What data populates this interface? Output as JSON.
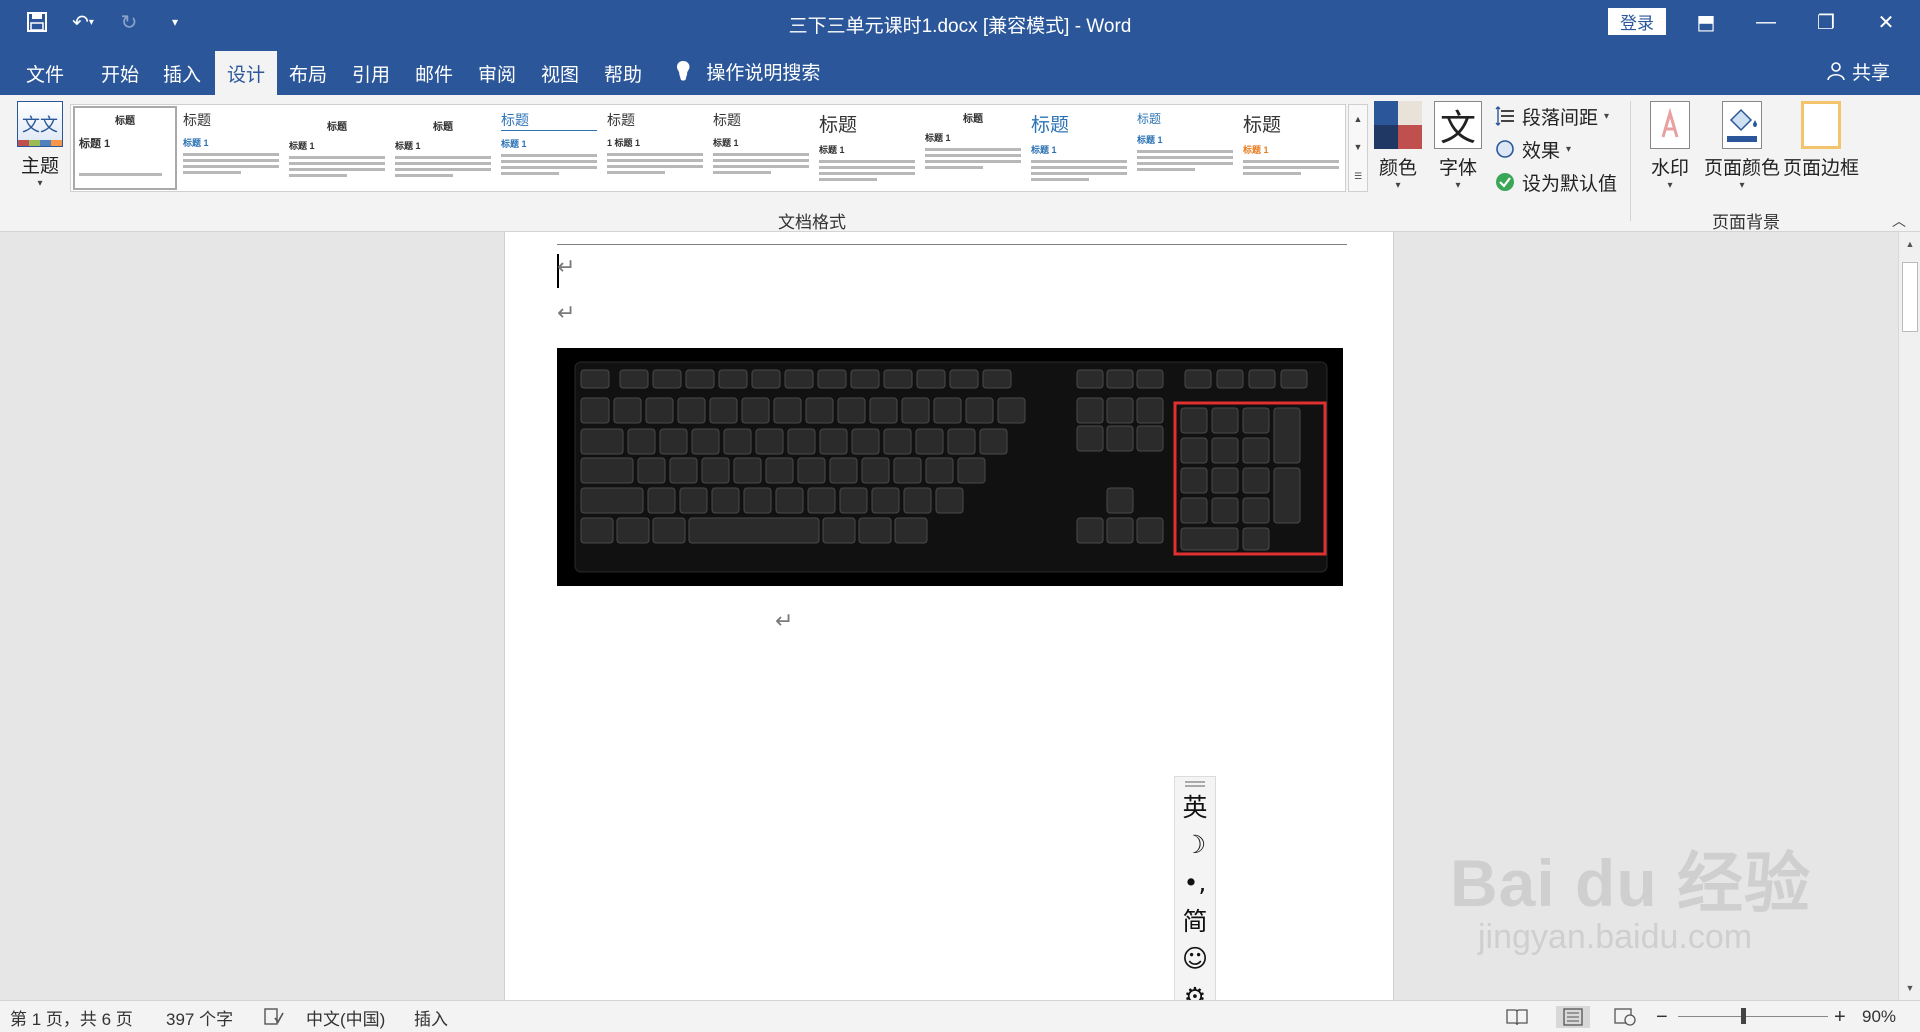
{
  "titlebar": {
    "title": "三下三单元课时1.docx [兼容模式]  -  Word",
    "login": "登录",
    "save_glyph": "💾",
    "undo_glyph": "↶",
    "undo_caret": "▾",
    "redo_glyph": "↻",
    "qat_more": "▾",
    "ribbon_display_glyph": "⬒",
    "minimize_glyph": "—",
    "restore_glyph": "❐",
    "close_glyph": "✕"
  },
  "tabs": [
    {
      "label": "文件"
    },
    {
      "label": "开始"
    },
    {
      "label": "插入"
    },
    {
      "label": "设计"
    },
    {
      "label": "布局"
    },
    {
      "label": "引用"
    },
    {
      "label": "邮件"
    },
    {
      "label": "审阅"
    },
    {
      "label": "视图"
    },
    {
      "label": "帮助"
    }
  ],
  "tell_me": {
    "label": "操作说明搜索",
    "icon": "lightbulb-icon",
    "glyph": "💡"
  },
  "share": {
    "label": "共享",
    "icon": "person-icon",
    "glyph": "👤"
  },
  "ribbon": {
    "theme": {
      "label": "主题",
      "glyph": "文文"
    },
    "styles": [
      {
        "title": "标题",
        "sub": "标题 1"
      },
      {
        "title": "标题",
        "sub": "标题 1"
      },
      {
        "title": "标题",
        "sub": "标题 1"
      },
      {
        "title": "标题",
        "sub": "标题 1"
      },
      {
        "title": "标题",
        "sub": "标题 1"
      },
      {
        "title": "标题",
        "sub": "1  标题 1"
      },
      {
        "title": "标题",
        "sub": "标题 1"
      },
      {
        "title": "标题",
        "sub": "标题 1"
      },
      {
        "title": "标题",
        "sub": "标题 1"
      },
      {
        "title": "标题",
        "sub": "标题 1"
      },
      {
        "title": "标题",
        "sub": "标题 1"
      },
      {
        "title": "标题",
        "sub": "标题 1"
      }
    ],
    "colors": {
      "label": "颜色",
      "swatches": [
        "#2b579a",
        "#e8e2d8",
        "#1f3864",
        "#c0504d"
      ]
    },
    "fonts": {
      "label": "字体",
      "glyph": "文"
    },
    "paragraph_spacing": {
      "label": "段落间距"
    },
    "effects": {
      "label": "效果"
    },
    "set_default": {
      "label": "设为默认值"
    },
    "group_doc_format": "文档格式",
    "watermark": {
      "label": "水印"
    },
    "page_color": {
      "label": "页面颜色"
    },
    "page_borders": {
      "label": "页面边框"
    },
    "group_page_background": "页面背景"
  },
  "document": {
    "para_mark": "↵",
    "keyboard_image_alt": "keyboard"
  },
  "ime": {
    "items": [
      "英",
      "☽",
      "•,",
      "简",
      "☺",
      "⚙"
    ]
  },
  "status": {
    "page": "第 1 页，共 6 页",
    "words": "397 个字",
    "language": "中文(中国)",
    "mode": "插入",
    "zoom": "90%",
    "zoom_minus": "−",
    "zoom_plus": "+"
  },
  "watermark": {
    "top": "Bai du 经验",
    "bottom": "jingyan.baidu.com"
  }
}
